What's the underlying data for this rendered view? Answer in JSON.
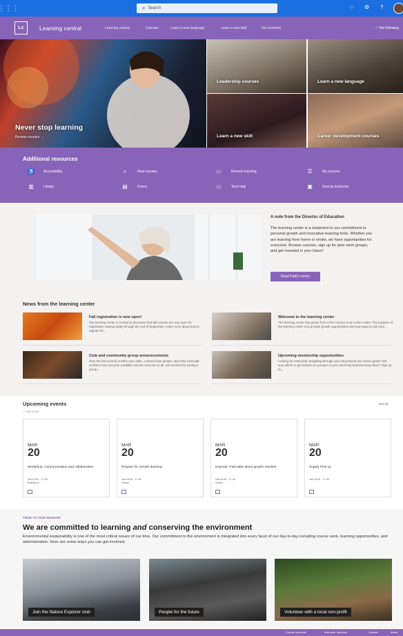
{
  "suite_bar": {
    "search_placeholder": "Search",
    "icons": [
      "waffle-icon",
      "search-icon",
      "bell-icon",
      "gear-icon",
      "help-icon",
      "avatar"
    ]
  },
  "site": {
    "logo": "Lc",
    "title": "Learning central",
    "nav": [
      "Learning central",
      "Courses",
      "Learn a new language",
      "Learn a new skill",
      "Get involved"
    ],
    "follow": "Not following"
  },
  "hero": {
    "main_title": "Never stop learning",
    "main_link": "Review courses →",
    "tiles": [
      "Leadership courses",
      "Learn a new language",
      "Learn a new skill",
      "Career development courses"
    ]
  },
  "resources": {
    "heading": "Additional resources",
    "items": [
      {
        "label": "Accessibility",
        "icon": "accessibility-icon"
      },
      {
        "label": "Find courses",
        "icon": "search-icon"
      },
      {
        "label": "Remote learning",
        "icon": "laptop-icon"
      },
      {
        "label": "My courses",
        "icon": "list-icon"
      },
      {
        "label": "Library",
        "icon": "library-icon"
      },
      {
        "label": "Forms",
        "icon": "forms-icon"
      },
      {
        "label": "Tech help",
        "icon": "laptop-icon"
      },
      {
        "label": "Find an instructor",
        "icon": "contact-card-icon"
      }
    ]
  },
  "director": {
    "heading": "A note from the Director of Education",
    "body": "The learning center is a testament to our commitment to personal growth and innovative learning tools. Whether you are learning from home or onsite, we have opportunities for everyone. Browse courses, sign up for peer work groups, and get invested in your future!",
    "button": "Read Patti's memo"
  },
  "news": {
    "heading": "News from the learning center",
    "items": [
      {
        "title": "Fall registration is now open!",
        "desc": "The learning center is excited to announce that fall courses are now open for registration starting today through the end of September. Learn more about how to register for..."
      },
      {
        "title": "Welcome to the learning center",
        "desc": "The learning center has grown from a few courses to an entire center. The purpose of the learning center is to provide growth opportunities and new ways to use your..."
      },
      {
        "title": "Club and community group announcements",
        "desc": "Over the last several months new clubs, communicate groups, and extra curricular activities have become available and are welcome to all. Get involved by joining a group..."
      },
      {
        "title": "Upcoming mentorship opportunities",
        "desc": "Looking for extra help navigating through your educational and career goals? Not sure where to get started on a project or just need help brainstorming ideas? Sign up to..."
      }
    ]
  },
  "events": {
    "heading": "Upcoming events",
    "add": "+ Add event",
    "see_all": "See all",
    "items": [
      {
        "month": "MAR",
        "day": "20",
        "title": "Workshop: Communication and collaboration",
        "time": "Sat 14:00 - 17:00",
        "location": "Building 8"
      },
      {
        "month": "MAR",
        "day": "20",
        "title": "Prepare for remote learning",
        "time": "Sat 16:00 - 17:00",
        "location": "Online"
      },
      {
        "month": "MAR",
        "day": "20",
        "title": "Keynote: Patti talks about growth mindset",
        "time": "Sat 16:00 - 17:00",
        "location": "Online"
      },
      {
        "month": "MAR",
        "day": "20",
        "title": "Supply Pick up",
        "time": "Sat 16:00 - 17:00",
        "location": ""
      }
    ]
  },
  "mission": {
    "kicker": "TRUE TO OUR MISSION",
    "title_pre": "We are committed to learning ",
    "title_em": "and",
    "title_post": " conserving the environment",
    "body": "Environmental sustainability is one of the most critical issues of our time. Our commitment to the environment is integrated into every facet of our day-to-day including course work, learning opportunities, and administration. Here are some ways you can get involved.",
    "tiles": [
      "Join the Nature Explorer club",
      "People for the future",
      "Volunteer with a local non-profit"
    ]
  },
  "footer": {
    "links": [
      "Course schedule",
      "Instructor directory",
      "Contact",
      "About"
    ]
  },
  "colors": {
    "suite": "#1b6fe0",
    "brand": "#8764b8"
  }
}
